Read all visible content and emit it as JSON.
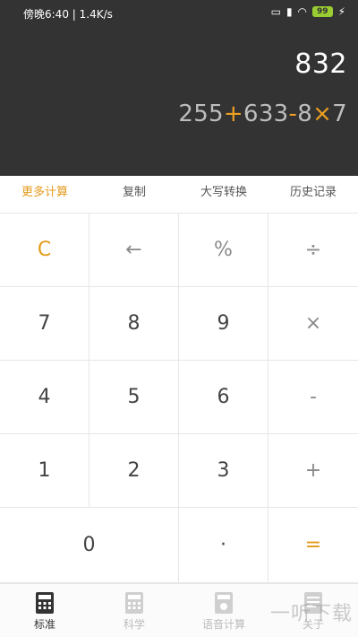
{
  "status": {
    "time": "傍晚6:40 | 1.4K/s",
    "battery": "99"
  },
  "display": {
    "result": "832",
    "expression": [
      "255",
      "+",
      "633",
      "-",
      "8",
      "×",
      "7"
    ]
  },
  "func_bar": {
    "items": [
      "更多计算",
      "复制",
      "大写转换",
      "历史记录"
    ]
  },
  "keys": [
    "C",
    "←",
    "%",
    "÷",
    "7",
    "8",
    "9",
    "×",
    "4",
    "5",
    "6",
    "-",
    "1",
    "2",
    "3",
    "+",
    "0",
    "·",
    "="
  ],
  "tabs": [
    "标准",
    "科学",
    "语音计算",
    "关于"
  ],
  "watermark": "一听下载",
  "colors": {
    "accent": "#e39a1a",
    "display_bg": "#333333"
  }
}
